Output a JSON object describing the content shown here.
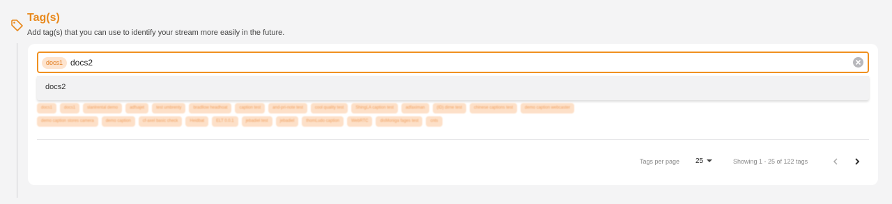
{
  "section": {
    "title": "Tag(s)",
    "description": "Add tag(s) that you can use to identify your stream more easily in the future.",
    "icon": "tag-icon",
    "accent_color": "#e8891d"
  },
  "input": {
    "chip_label": "docs1",
    "value": "docs2",
    "clear_icon": "clear-circle-icon"
  },
  "dropdown": {
    "items": [
      {
        "label": "docs2"
      }
    ]
  },
  "tags": {
    "row1": [
      "docs1",
      "docs1",
      "slanlrental demo",
      "adfsajet",
      "test umbrenty",
      "bradllow headhoat",
      "caption test",
      "and-pri-note test",
      "cool quality test",
      "ShingLA caption test",
      "adfaximan",
      "(ID) dirne test",
      "chinese captions test",
      "demo caption webcaster"
    ],
    "row2": [
      "demo caption stores camera",
      "demo caption",
      "cf-axel basic check",
      "Heidbat",
      "ELT 0.0.1",
      "jebadiel test",
      "jebadiel",
      "thomLudo caption",
      "WebRTC",
      "disMoniga fages test",
      "cnts"
    ]
  },
  "pagination": {
    "per_page_label": "Tags per page",
    "per_page_value": "25",
    "showing_text": "Showing 1 - 25 of 122 tags",
    "prev_icon": "chevron-left-icon",
    "next_icon": "chevron-right-icon"
  }
}
